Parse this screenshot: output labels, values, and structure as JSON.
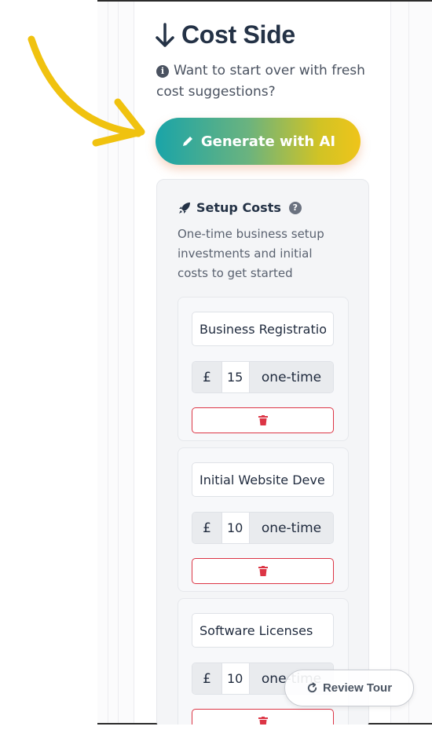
{
  "colors": {
    "heading": "#243246",
    "accent_gradient_start": "#1aa4a8",
    "accent_gradient_end": "#efc41a",
    "delete_red": "#dc3545",
    "arrow_yellow": "#f0c20f"
  },
  "header": {
    "icon": "arrow-down-icon",
    "title": "Cost Side"
  },
  "hint": {
    "icon": "info-icon",
    "text": "Want to start over with fresh cost suggestions?"
  },
  "generate_button": {
    "icon": "pencil-icon",
    "label": "Generate with AI"
  },
  "setup": {
    "icon": "rocket-icon",
    "title": "Setup Costs",
    "help_icon": "question-icon",
    "description": "One-time business setup investments and initial costs to get started",
    "items": [
      {
        "name": "Business Registration",
        "currency": "£",
        "amount": "15",
        "frequency": "one-time",
        "delete_icon": "trash-icon"
      },
      {
        "name": "Initial Website Development",
        "currency": "£",
        "amount": "10",
        "frequency": "one-time",
        "delete_icon": "trash-icon"
      },
      {
        "name": "Software Licenses",
        "currency": "£",
        "amount": "10",
        "frequency": "one-time",
        "delete_icon": "trash-icon"
      }
    ]
  },
  "tour_button": {
    "icon": "refresh-icon",
    "label": "Review Tour"
  }
}
